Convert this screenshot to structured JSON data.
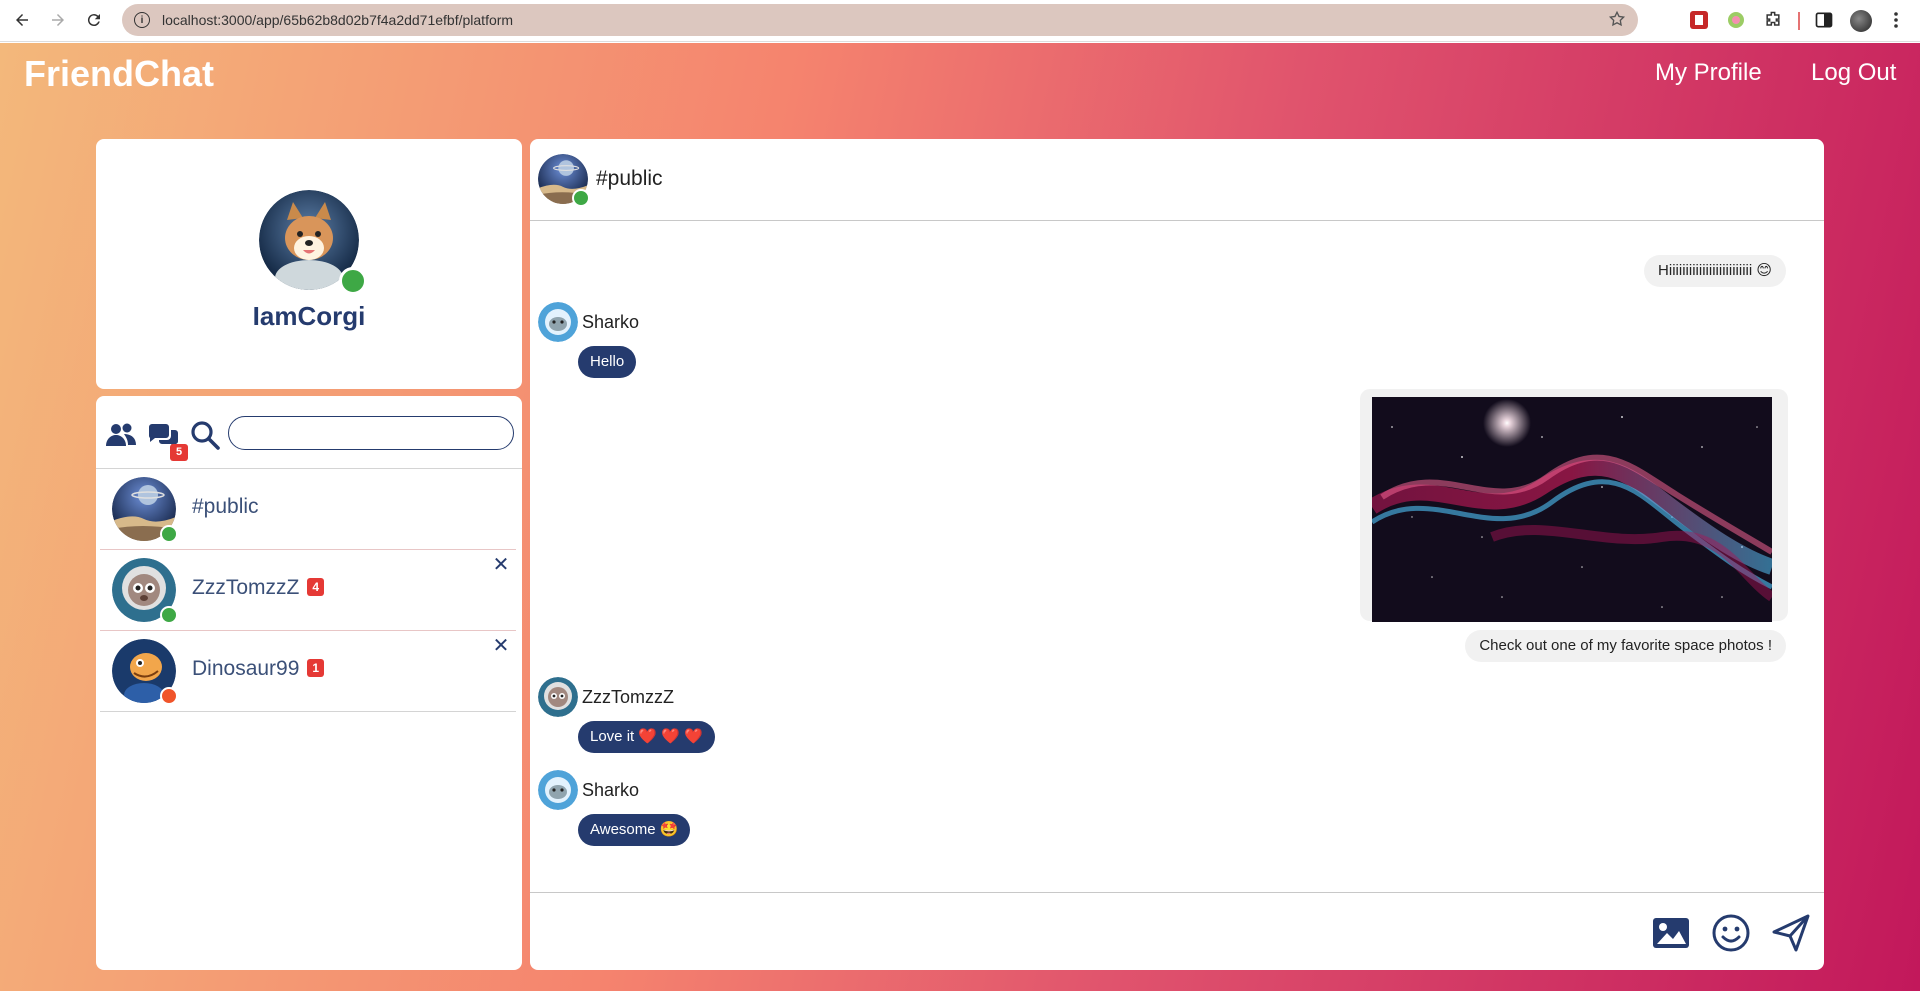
{
  "browser": {
    "url": "localhost:3000/app/65b62b8d02b7f4a2dd71efbf/platform"
  },
  "app": {
    "brand": "FriendChat",
    "nav": {
      "profile": "My Profile",
      "logout": "Log Out"
    }
  },
  "profile": {
    "username": "IamCorgi",
    "status_color": "#3ea845"
  },
  "sidebar": {
    "unread_total": "5",
    "search": {
      "value": "",
      "placeholder": ""
    },
    "contacts": [
      {
        "name": "#public",
        "badge": "",
        "status_color": "#3ea845",
        "closable": false
      },
      {
        "name": "ZzzTomzzZ",
        "badge": "4",
        "status_color": "#3ea845",
        "closable": true
      },
      {
        "name": "Dinosaur99",
        "badge": "1",
        "status_color": "#f0542a",
        "closable": true
      }
    ]
  },
  "chat": {
    "channel": "#public",
    "messages": [
      {
        "from": "me",
        "text": "Hiiiiiiiiiiiiiiiiiiiiiiiii 😊"
      },
      {
        "from": "Sharko",
        "text": "Hello"
      },
      {
        "from": "me",
        "type": "image",
        "caption": "Check out one of my favorite space photos !"
      },
      {
        "from": "ZzzTomzzZ",
        "text": "Love it ❤️ ❤️ ❤️"
      },
      {
        "from": "Sharko",
        "text": "Awesome 🤩"
      }
    ]
  },
  "colors": {
    "primary": "#253b6e",
    "online": "#3ea845",
    "away": "#f0542a",
    "badge": "#e53935"
  }
}
